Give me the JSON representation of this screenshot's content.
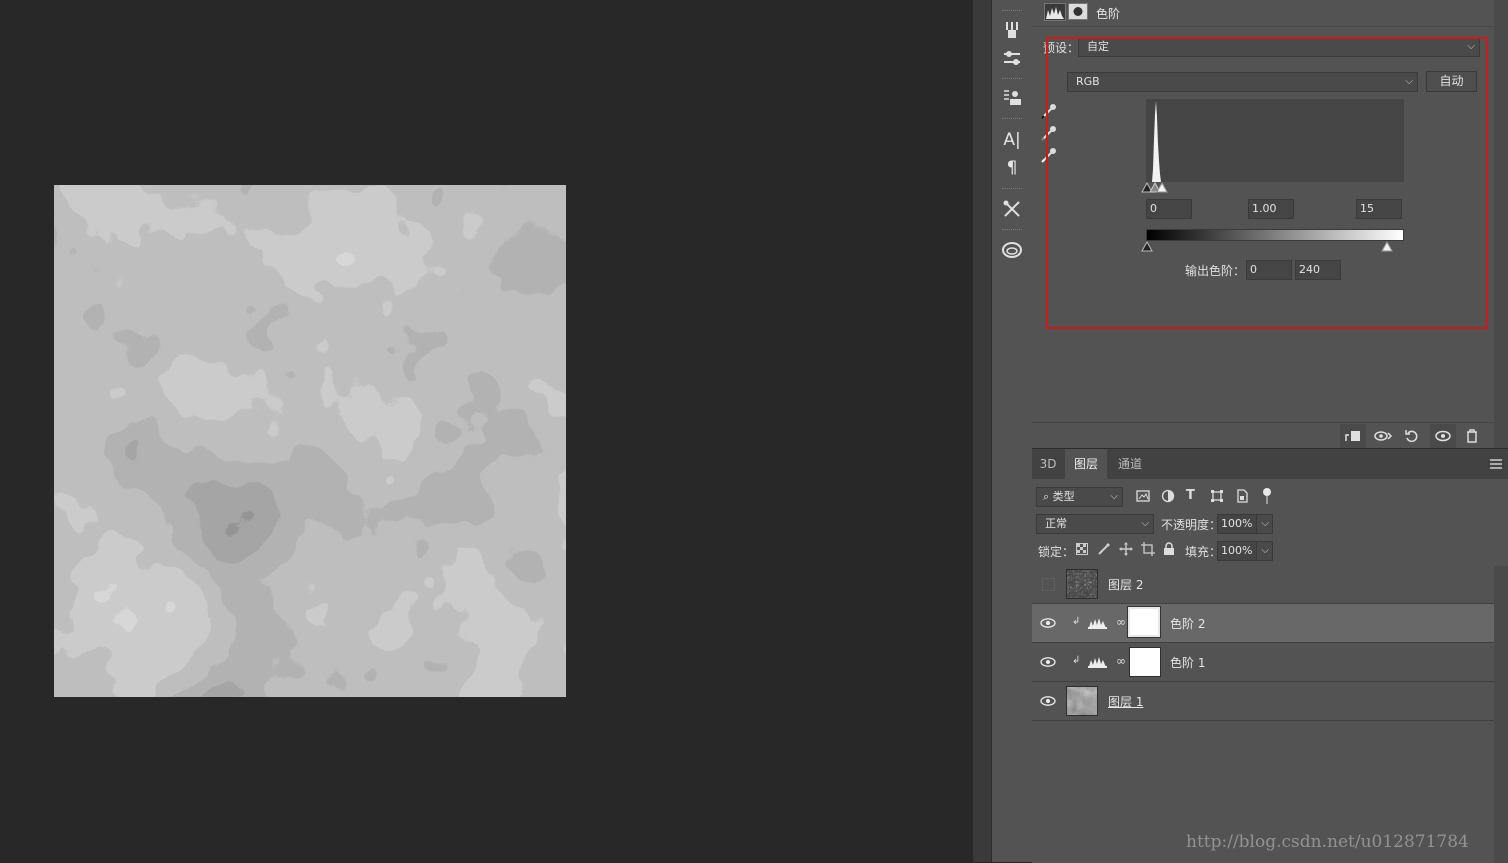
{
  "properties": {
    "adjustment_label": "色阶",
    "preset_label": "预设：",
    "preset_value": "自定",
    "channel_value": "RGB",
    "auto_button": "自动",
    "input_black": "0",
    "input_gamma": "1.00",
    "input_white": "15",
    "output_label": "输出色阶：",
    "output_black": "0",
    "output_white": "240"
  },
  "layers_panel": {
    "tabs": [
      {
        "label": "3D"
      },
      {
        "label": "图层"
      },
      {
        "label": "通道"
      }
    ],
    "filter_label": "类型",
    "blend_mode": "正常",
    "opacity_label": "不透明度：",
    "opacity_value": "100%",
    "lock_label": "锁定：",
    "fill_label": "填充：",
    "fill_value": "100%",
    "layers": [
      {
        "name": "图层 2",
        "visible": false,
        "type": "noise"
      },
      {
        "name": "色阶 2",
        "visible": true,
        "type": "adjustment",
        "selected": true
      },
      {
        "name": "色阶 1",
        "visible": true,
        "type": "adjustment"
      },
      {
        "name": "图层 1",
        "visible": true,
        "type": "clouds"
      }
    ]
  },
  "watermark": "http://blog.csdn.net/u012871784",
  "colors": {
    "highlight": "#cc1b1b",
    "panel": "#535353",
    "canvas_bg": "#282828"
  }
}
